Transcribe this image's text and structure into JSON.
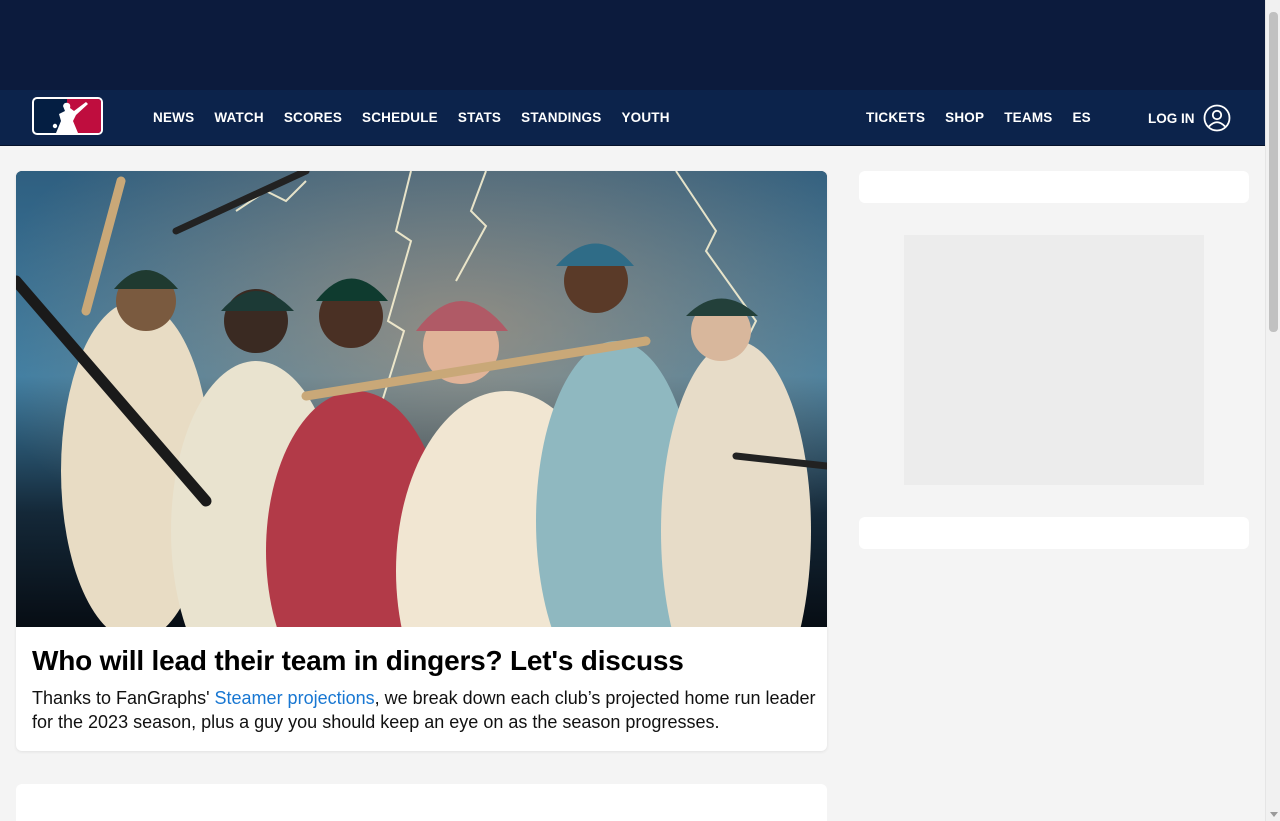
{
  "header": {
    "nav_left": [
      "NEWS",
      "WATCH",
      "SCORES",
      "SCHEDULE",
      "STATS",
      "STANDINGS",
      "YOUTH"
    ],
    "nav_right": [
      "TICKETS",
      "SHOP",
      "TEAMS",
      "ES"
    ],
    "login_label": "LOG IN",
    "logo_icon": "mlb-logo",
    "user_icon": "user-circle-icon"
  },
  "main_story": {
    "headline": "Who will lead their team in dingers? Let's discuss",
    "blurb_before": "Thanks to FanGraphs' ",
    "blurb_link": "Steamer projections",
    "blurb_after": ", we break down each club’s projected home run leader for the 2023 season, plus a guy you should keep an eye on as the season progresses."
  },
  "colors": {
    "nav_bg": "#0c234b",
    "ad_bg": "#0c1b3d",
    "link": "#1877d2",
    "logo_red": "#bf0d3e",
    "logo_blue": "#041e42"
  }
}
